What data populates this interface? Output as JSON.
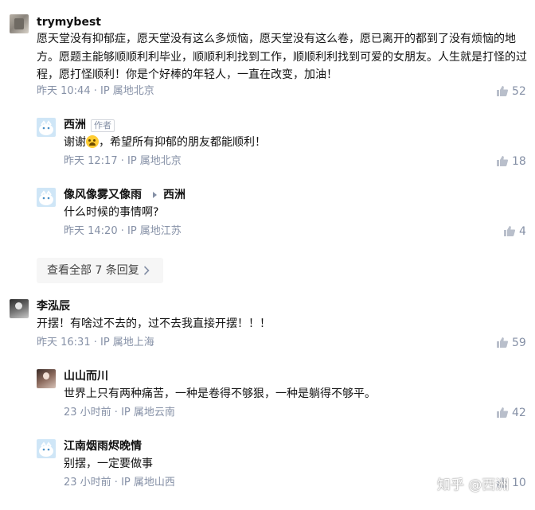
{
  "comments": [
    {
      "user": "trymybest",
      "text": "愿天堂没有抑郁症，愿天堂没有这么多烦恼，愿天堂没有这么卷，愿已离开的都到了没有烦恼的地方。愿题主能够顺顺利利毕业，顺顺利利找到工作，顺顺利利找到可爱的女朋友。人生就是打怪的过程，愿打怪顺利！你是个好棒的年轻人，一直在改变，加油！",
      "meta": "昨天 10:44 · IP 属地北京",
      "likes": "52",
      "replies": [
        {
          "user": "西洲",
          "author_tag": "作者",
          "text_before_emoji": "谢谢",
          "emoji": "crying-face-emoji",
          "text_after_emoji": "，希望所有抑郁的朋友都能顺利！",
          "meta": "昨天 12:17 · IP 属地北京",
          "likes": "18"
        },
        {
          "user": "像风像雾又像雨",
          "reply_to": "西洲",
          "text": "什么时候的事情啊?",
          "meta": "昨天 14:20 · IP 属地江苏",
          "likes": "4"
        }
      ],
      "view_all_label": "查看全部 7 条回复"
    },
    {
      "user": "李泓辰",
      "text": "开摆！有啥过不去的，过不去我直接开摆！！！",
      "meta": "昨天 16:31 · IP 属地上海",
      "likes": "59",
      "replies": [
        {
          "user": "山山而川",
          "text": "世界上只有两种痛苦，一种是卷得不够狠，一种是躺得不够平。",
          "meta": "23 小时前 · IP 属地云南",
          "likes": "42"
        },
        {
          "user": "江南烟雨烬晚情",
          "text": "别摆，一定要做事",
          "meta": "23 小时前 · IP 属地山西",
          "likes": "10"
        }
      ]
    }
  ],
  "watermark": "知乎 @西洲",
  "colors": {
    "text": "#121212",
    "meta": "#8590a6",
    "button_bg": "#f6f6f6"
  }
}
